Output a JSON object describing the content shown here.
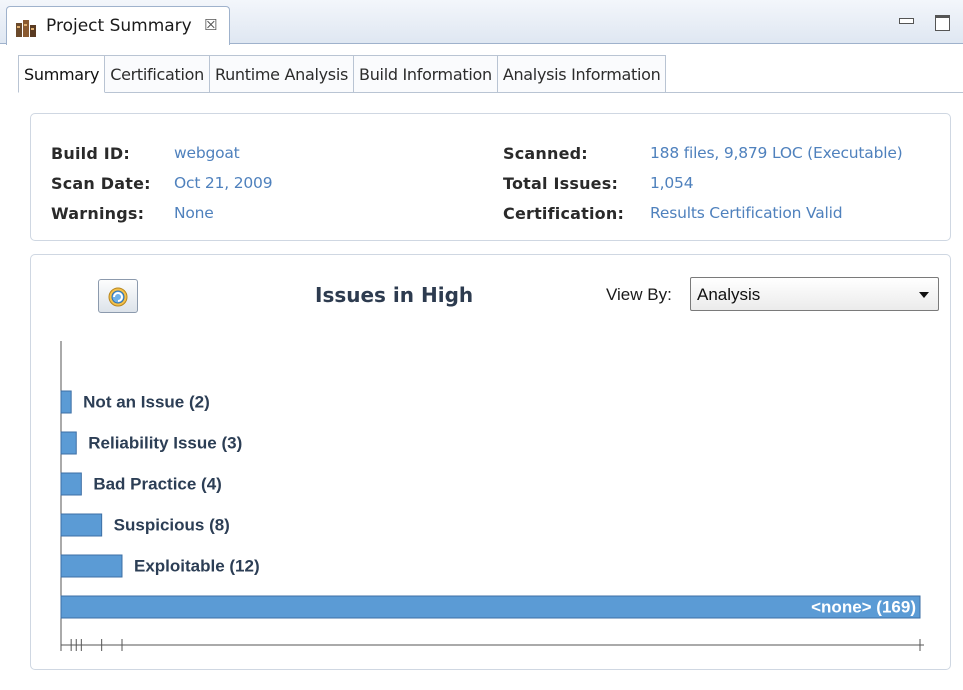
{
  "view_tab": {
    "label": "Project Summary",
    "close": "☒"
  },
  "tabs": [
    {
      "label": "Summary",
      "active": true
    },
    {
      "label": "Certification",
      "active": false
    },
    {
      "label": "Runtime Analysis",
      "active": false
    },
    {
      "label": "Build Information",
      "active": false
    },
    {
      "label": "Analysis Information",
      "active": false
    }
  ],
  "info": {
    "build_id_label": "Build ID:",
    "build_id": "webgoat",
    "scan_date_label": "Scan Date:",
    "scan_date": "Oct 21, 2009",
    "warnings_label": "Warnings:",
    "warnings": "None",
    "scanned_label": "Scanned:",
    "scanned": "188 files, 9,879 LOC (Executable)",
    "total_issues_label": "Total Issues:",
    "total_issues": "1,054",
    "certification_label": "Certification:",
    "certification": "Results Certification Valid"
  },
  "chart_controls": {
    "view_by_label": "View By:",
    "view_by_value": "Analysis"
  },
  "colors": {
    "bar": "#5b9bd5",
    "bar_border": "#3d6fa5",
    "link": "#4f81bd"
  },
  "icons": {
    "view_tab": "project-summary-icon",
    "refresh": "refresh-icon"
  },
  "chart_data": {
    "type": "bar",
    "orientation": "horizontal",
    "title": "Issues in High",
    "categories": [
      "Not an Issue",
      "Reliability Issue",
      "Bad Practice",
      "Suspicious",
      "Exploitable",
      "<none>"
    ],
    "values": [
      2,
      3,
      4,
      8,
      12,
      169
    ],
    "labels": [
      "Not an Issue (2)",
      "Reliability Issue (3)",
      "Bad Practice (4)",
      "Suspicious (8)",
      "Exploitable (12)",
      "<none> (169)"
    ],
    "xlim": [
      0,
      169
    ],
    "grid": false,
    "legend": "none"
  }
}
